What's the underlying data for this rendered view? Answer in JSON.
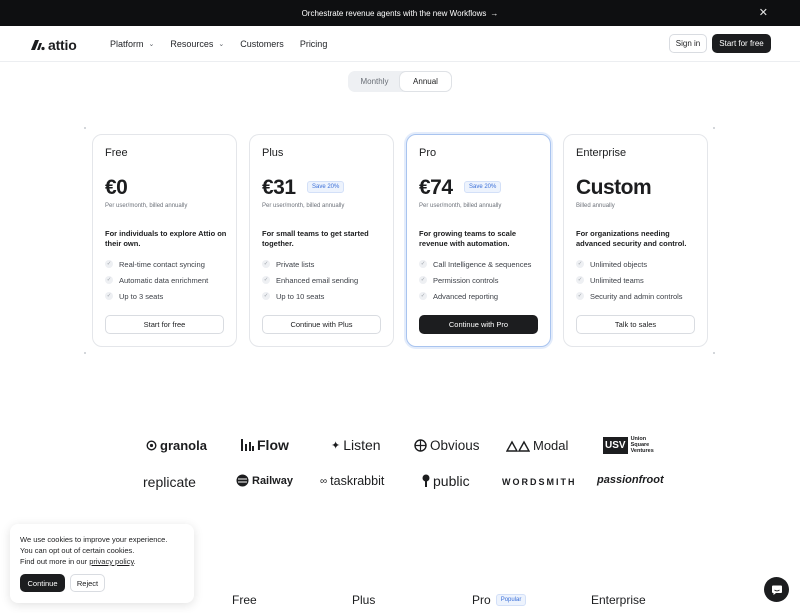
{
  "announcement": {
    "text": "Orchestrate revenue agents with the new Workflows",
    "arrow": "→",
    "close": "✕"
  },
  "nav": {
    "logo": "attio",
    "menu": [
      {
        "label": "Platform",
        "has_dropdown": true
      },
      {
        "label": "Resources",
        "has_dropdown": true
      },
      {
        "label": "Customers",
        "has_dropdown": false
      },
      {
        "label": "Pricing",
        "has_dropdown": false
      }
    ],
    "sign_in": "Sign in",
    "start_free": "Start for free"
  },
  "billing_toggle": {
    "options": [
      "Monthly",
      "Annual"
    ],
    "selected": "Annual"
  },
  "plans": [
    {
      "name": "Free",
      "price": "€0",
      "save": "",
      "billed": "Per user/month, billed annually",
      "description": "For individuals to explore Attio on their own.",
      "features": [
        "Real-time contact syncing",
        "Automatic data enrichment",
        "Up to 3 seats"
      ],
      "cta": "Start for free",
      "highlight": false
    },
    {
      "name": "Plus",
      "price": "€31",
      "save": "Save 20%",
      "billed": "Per user/month, billed annually",
      "description": "For small teams to get started together.",
      "features": [
        "Private lists",
        "Enhanced email sending",
        "Up to 10 seats"
      ],
      "cta": "Continue with Plus",
      "highlight": false
    },
    {
      "name": "Pro",
      "price": "€74",
      "save": "Save 20%",
      "billed": "Per user/month, billed annually",
      "description": "For growing teams to scale revenue with automation.",
      "features": [
        "Call Intelligence & sequences",
        "Permission controls",
        "Advanced reporting"
      ],
      "cta": "Continue with Pro",
      "highlight": true
    },
    {
      "name": "Enterprise",
      "price": "Custom",
      "save": "",
      "billed": "Billed annually",
      "description": "For organizations needing advanced security and control.",
      "features": [
        "Unlimited objects",
        "Unlimited teams",
        "Security and admin controls"
      ],
      "cta": "Talk to sales",
      "highlight": false
    }
  ],
  "customer_logos": {
    "granola": "granola",
    "flow": "Flow",
    "listen": "Listen",
    "obvious": "Obvious",
    "modal": "Modal",
    "usv_mark": "USV",
    "usv_line1": "Union",
    "usv_line2": "Square",
    "usv_line3": "Ventures",
    "replicate": "replicate",
    "railway": "Railway",
    "taskrabbit": "taskrabbit",
    "public": "public",
    "wordsmith": "WORDSMITH",
    "passionfroot": "passionfroot"
  },
  "cookie_banner": {
    "line1": "We use cookies to improve your experience.",
    "line2": "You can opt out of certain cookies.",
    "line3_prefix": "Find out more in our ",
    "link": "privacy policy",
    "line3_suffix": ".",
    "continue": "Continue",
    "reject": "Reject"
  },
  "comparison_header": {
    "columns": [
      "Free",
      "Plus",
      "Pro",
      "Enterprise"
    ],
    "popular_badge": "Popular"
  },
  "colors": {
    "dark": "#1c1d1f",
    "accent_blue": "#3a6fd8",
    "highlight_border": "#a9c4ef"
  }
}
